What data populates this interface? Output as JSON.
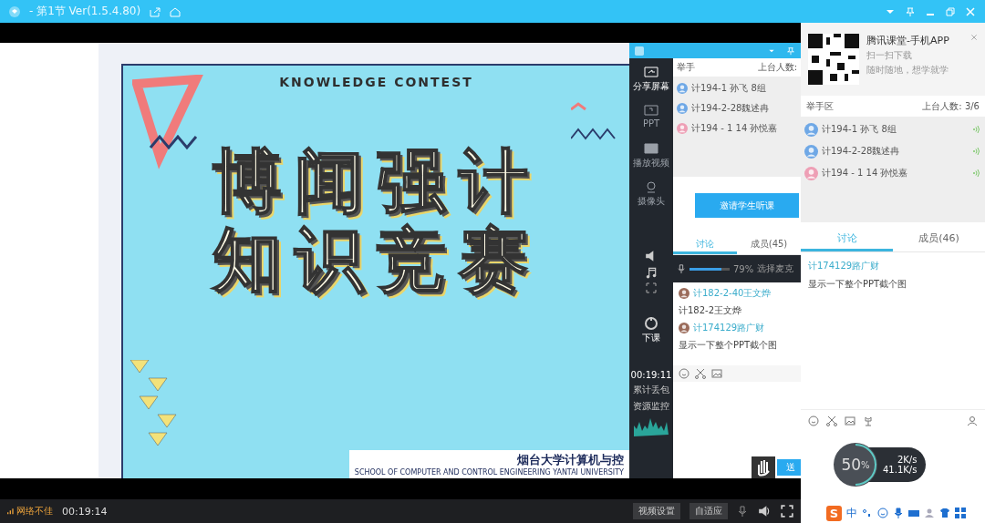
{
  "window": {
    "title": "- 第1节 Ver(1.5.4.80)"
  },
  "slide": {
    "heading": "KNOWLEDGE CONTEST",
    "title_lines": [
      "博闻强计",
      "知识竞赛"
    ],
    "school_cn": "烟台大学计算机与控",
    "school_en": "SCHOOL OF COMPUTER AND CONTROL ENGINEERING  YANTAI UNIVERSITY"
  },
  "shared_app": {
    "tools": [
      {
        "label": "分享屏幕",
        "selected": true
      },
      {
        "label": "PPT",
        "selected": false
      },
      {
        "label": "播放视频",
        "selected": false
      },
      {
        "label": "摄像头",
        "selected": false
      }
    ],
    "end_label": "下课",
    "timer": "00:19:11",
    "loss_label": "累计丢包",
    "monitor_label": "资源监控",
    "hand_header": "举手",
    "count_label": "上台人数:",
    "raised_hands": [
      {
        "name": "计194-1 孙飞 8组",
        "color": "#6fa8e6"
      },
      {
        "name": "计194-2-28魏述冉",
        "color": "#6fa8e6"
      },
      {
        "name": "计194 - 1 14 孙悦嘉",
        "color": "#ee9fb5"
      }
    ],
    "invite_button": "邀请学生听课",
    "tabs": [
      {
        "label": "讨论",
        "selected": true
      },
      {
        "label": "成员(45)",
        "selected": false
      }
    ],
    "mic": {
      "level": 0.79,
      "reading": "79%",
      "select_label": "选择麦克"
    },
    "messages": [
      {
        "author": "计182-2-40王文烨",
        "text": "计182-2王文烨"
      },
      {
        "author": "计174129路广财",
        "text": "显示一下整个PPT截个图"
      }
    ],
    "send_label": "送"
  },
  "bottom_bar": {
    "network": "网络不佳",
    "elapsed": "00:19:14",
    "buttons": [
      "视频设置",
      "自适应"
    ]
  },
  "side_panel": {
    "app_title": "腾讯课堂-手机APP",
    "app_lines": [
      "扫一扫下载",
      "随时随地，想学就学"
    ],
    "hand_header": "举手区",
    "count": "上台人数: 3/6",
    "raised_hands": [
      {
        "name": "计194-1 孙飞 8组",
        "color": "#6fa8e6"
      },
      {
        "name": "计194-2-28魏述冉",
        "color": "#6fa8e6"
      },
      {
        "name": "计194 - 1 14 孙悦嘉",
        "color": "#ee9fb5"
      }
    ],
    "tabs": [
      {
        "label": "讨论",
        "selected": true
      },
      {
        "label": "成员(46)",
        "selected": false
      }
    ],
    "messages": [
      {
        "author": "计174129路广财",
        "text": "显示一下整个PPT截个图"
      }
    ]
  },
  "speed": {
    "percent": "50",
    "unit": "%",
    "level": 0.5,
    "up": "2K/s",
    "down": "41.1K/s"
  },
  "ime": {
    "logo": "S",
    "mode": "中"
  }
}
